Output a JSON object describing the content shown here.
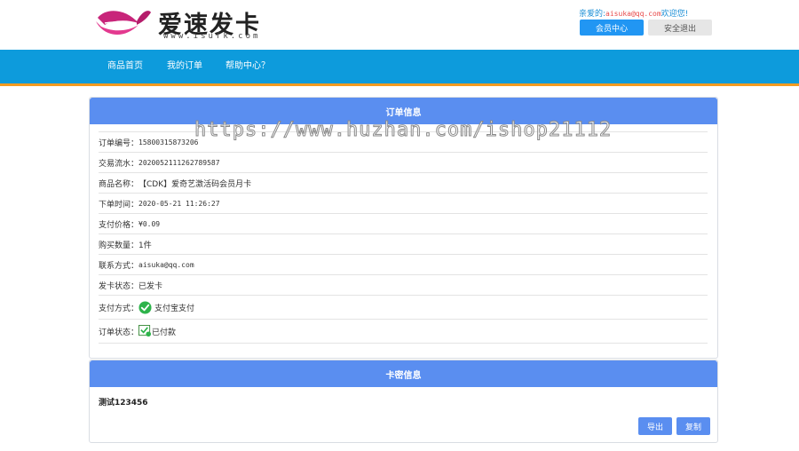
{
  "header": {
    "logo_title": "爱速发卡",
    "logo_url": "www.isufk.com",
    "greeting_prefix": "亲爱的:",
    "greeting_email": "aisuka@qq.com",
    "greeting_suffix": "欢迎您!",
    "member_center": "会员中心",
    "logout": "安全退出"
  },
  "nav": {
    "items": [
      "商品首页",
      "我的订单",
      "帮助中心？"
    ]
  },
  "order": {
    "title": "订单信息",
    "rows": [
      {
        "label": "订单编号：",
        "value": "15800315873206"
      },
      {
        "label": "交易流水：",
        "value": "2020052111262789587"
      },
      {
        "label": "商品名称：",
        "value": "【CDK】爱奇艺激活码会员月卡"
      },
      {
        "label": "下单时间：",
        "value": "2020-05-21 11:26:27"
      },
      {
        "label": "支付价格：",
        "value": "¥0.09"
      },
      {
        "label": "购买数量：",
        "value": "1件"
      },
      {
        "label": "联系方式：",
        "value": "aisuka@qq.com"
      },
      {
        "label": "发卡状态：",
        "value": "已发卡"
      },
      {
        "label": "支付方式：",
        "value": "支付宝支付",
        "icon": "check-circle-icon"
      },
      {
        "label": "订单状态：",
        "value": "已付款",
        "icon": "paid-status-icon"
      }
    ]
  },
  "card": {
    "title": "卡密信息",
    "content": "测试123456",
    "export": "导出",
    "copy": "复制"
  },
  "watermark": "https://www.huzhan.com/ishop21112",
  "colors": {
    "nav_bg": "#0d9bdc",
    "nav_accent": "#f29b21",
    "panel_head": "#5a8ef0",
    "primary_button": "#2196f3"
  }
}
